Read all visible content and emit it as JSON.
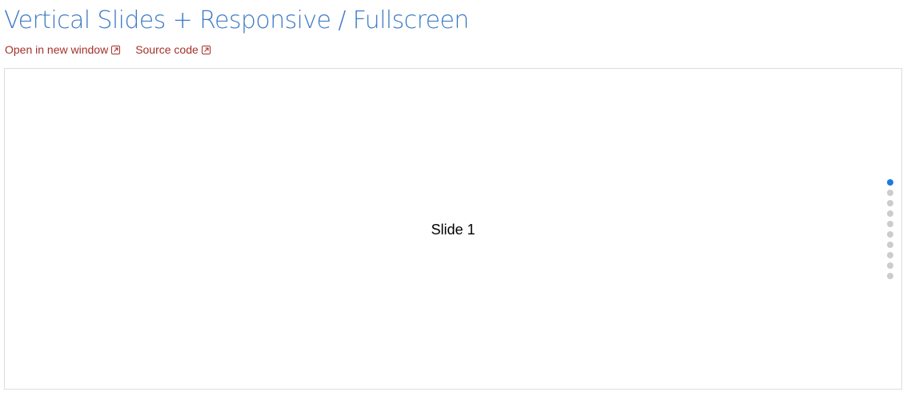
{
  "page": {
    "title": "Vertical Slides + Responsive / Fullscreen"
  },
  "links": {
    "open_new_window": {
      "label": "Open in new window",
      "icon": "external-link-icon"
    },
    "source_code": {
      "label": "Source code",
      "icon": "external-link-icon"
    }
  },
  "slider": {
    "current_slide_label": "Slide 1",
    "total_slides": 10,
    "active_index": 0,
    "colors": {
      "active_bullet": "#1f7ae0",
      "inactive_bullet": "#cccccc"
    }
  },
  "colors": {
    "title": "#3f7cc6",
    "link": "#a5312a",
    "frame_border": "#dddddd"
  }
}
